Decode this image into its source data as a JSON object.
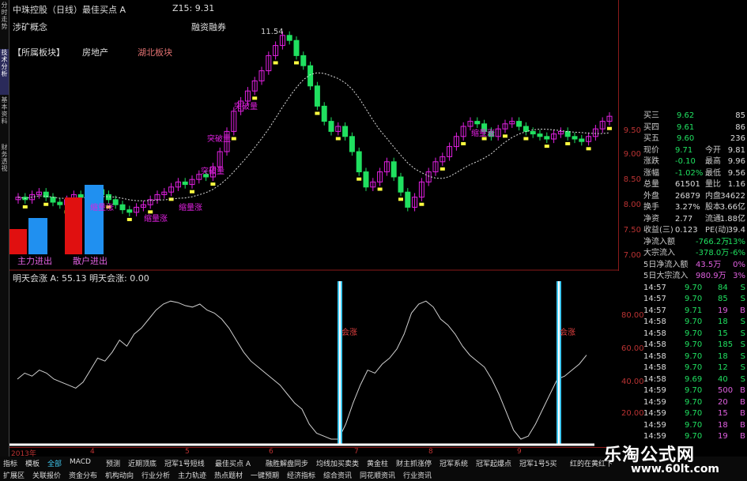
{
  "side_tabs": [
    "分时走势",
    "技术分析",
    "基本资料",
    "财务透视"
  ],
  "header": {
    "title": "中珠控股（日线）最佳买点 A",
    "z15": "Z15: 9.31"
  },
  "concept_label": "涉矿概念",
  "margin_label": "融资融券",
  "sector_label": "【所属板块】",
  "sector_items": [
    "房地产",
    "湖北板块"
  ],
  "high_marker": "11.54",
  "annotations": {
    "breakout": "突破量",
    "shrink": "缩量涨"
  },
  "flow_labels": [
    "主力进出",
    "散户进出"
  ],
  "osc_title": "明天会涨 A: 55.13  明天会涨: 0.00",
  "osc_spike_label": "会涨",
  "price_ticks": [
    "9.50",
    "9.00",
    "8.50",
    "8.00",
    "7.50",
    "7.00"
  ],
  "osc_ticks": [
    "80.00",
    "60.00",
    "40.00",
    "20.00"
  ],
  "date_ticks": [
    "2013年",
    "4",
    "5",
    "6",
    "7",
    "8",
    "9"
  ],
  "order_book": [
    {
      "label": "买三",
      "price": "9.62",
      "vol": "85"
    },
    {
      "label": "买四",
      "price": "9.61",
      "vol": "86"
    },
    {
      "label": "买五",
      "price": "9.60",
      "vol": "236"
    }
  ],
  "stats": [
    {
      "l1": "现价",
      "v1": "9.71",
      "l2": "今开",
      "v2": "9.81"
    },
    {
      "l1": "涨跌",
      "v1": "-0.10",
      "l2": "最高",
      "v2": "9.96"
    },
    {
      "l1": "涨幅",
      "v1": "-1.02%",
      "l2": "最低",
      "v2": "9.56"
    },
    {
      "l1": "总量",
      "v1": "61501",
      "l2": "量比",
      "v2": "1.16"
    },
    {
      "l1": "外盘",
      "v1": "26879",
      "l2": "内盘",
      "v2": "34622"
    },
    {
      "l1": "换手",
      "v1": "3.27%",
      "l2": "股本",
      "v2": "3.66亿"
    },
    {
      "l1": "净资",
      "v1": "2.77",
      "l2": "流通",
      "v2": "1.88亿"
    },
    {
      "l1": "收益(三)",
      "v1": "0.123",
      "l2": "PE(动)",
      "v2": "39.4"
    }
  ],
  "flows": [
    {
      "l": "净流入额",
      "v": "-766.2万",
      "p": "-13%"
    },
    {
      "l": "大宗流入",
      "v": "-378.0万",
      "p": "-6%"
    },
    {
      "l": "5日净流入额",
      "v": "43.5万",
      "p": "0%"
    },
    {
      "l": "5日大宗流入",
      "v": "980.9万",
      "p": "3%"
    }
  ],
  "ticks": [
    {
      "t": "14:57",
      "p": "9.70",
      "v": "84",
      "s": "S"
    },
    {
      "t": "14:57",
      "p": "9.70",
      "v": "85",
      "s": "S"
    },
    {
      "t": "14:57",
      "p": "9.71",
      "v": "19",
      "s": "B"
    },
    {
      "t": "14:58",
      "p": "9.70",
      "v": "18",
      "s": "S"
    },
    {
      "t": "14:58",
      "p": "9.70",
      "v": "15",
      "s": "S"
    },
    {
      "t": "14:58",
      "p": "9.70",
      "v": "185",
      "s": "S"
    },
    {
      "t": "14:58",
      "p": "9.70",
      "v": "18",
      "s": "S"
    },
    {
      "t": "14:58",
      "p": "9.70",
      "v": "12",
      "s": "S"
    },
    {
      "t": "14:58",
      "p": "9.69",
      "v": "40",
      "s": "S"
    },
    {
      "t": "14:59",
      "p": "9.70",
      "v": "500",
      "s": "B"
    },
    {
      "t": "14:59",
      "p": "9.70",
      "v": "20",
      "s": "B"
    },
    {
      "t": "14:59",
      "p": "9.70",
      "v": "15",
      "s": "B"
    },
    {
      "t": "14:59",
      "p": "9.70",
      "v": "18",
      "s": "B"
    },
    {
      "t": "14:59",
      "p": "9.70",
      "v": "19",
      "s": "B"
    }
  ],
  "bottom_tabs_row1": [
    "指标",
    "模板",
    "全部",
    "MACD",
    "预测",
    "近期顶底",
    "冠军1号短线",
    "最佳买点 A",
    "融胜解盘同步",
    "均线加买卖类",
    "黄金柱",
    "财主抓涨停",
    "冠军系统",
    "冠军起爆点",
    "冠军1号5买",
    "红的在黄红下"
  ],
  "bottom_tabs_row2": [
    "扩展区",
    "关联报价",
    "资金分布",
    "机构动向",
    "行业分析",
    "主力轨迹",
    "热点题材",
    "一键预期",
    "经济指标",
    "综合资讯",
    "同花顺资讯",
    "行业资讯"
  ],
  "watermark": {
    "name": "乐淘公式网",
    "url": "www.60lt.com"
  },
  "colors": {
    "up": "#e020e0",
    "down": "#20e060",
    "yellow": "#ffff40",
    "grid": "#8a1a1a",
    "spike": "#40c8f0"
  }
}
